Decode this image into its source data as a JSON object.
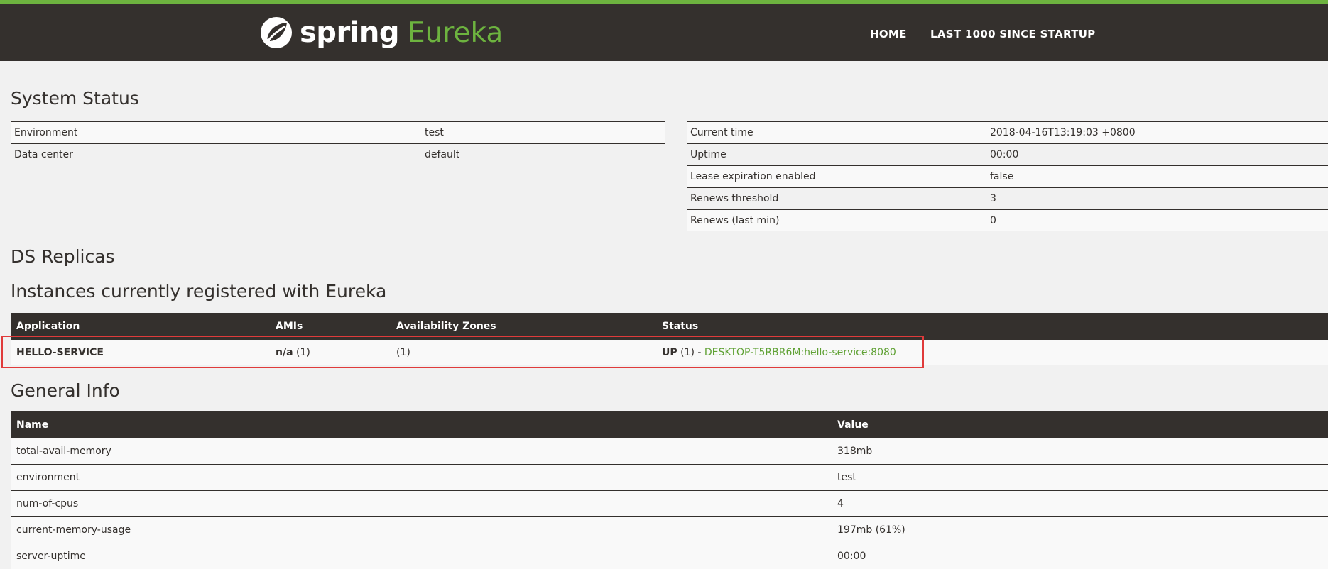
{
  "header": {
    "logo_spring": "spring",
    "logo_eureka": "Eureka",
    "nav_home": "HOME",
    "nav_last": "LAST 1000 SINCE STARTUP"
  },
  "colors": {
    "brand_green": "#6db33f",
    "header_bg": "#34302d",
    "highlight": "#e03b3b"
  },
  "system_status": {
    "title": "System Status",
    "left": [
      {
        "label": "Environment",
        "value": "test"
      },
      {
        "label": "Data center",
        "value": "default"
      }
    ],
    "right": [
      {
        "label": "Current time",
        "value": "2018-04-16T13:19:03 +0800"
      },
      {
        "label": "Uptime",
        "value": "00:00"
      },
      {
        "label": "Lease expiration enabled",
        "value": "false"
      },
      {
        "label": "Renews threshold",
        "value": "3"
      },
      {
        "label": "Renews (last min)",
        "value": "0"
      }
    ]
  },
  "ds_replicas": {
    "title": "DS Replicas"
  },
  "instances": {
    "title": "Instances currently registered with Eureka",
    "columns": [
      "Application",
      "AMIs",
      "Availability Zones",
      "Status"
    ],
    "rows": [
      {
        "application": "HELLO-SERVICE",
        "ami_name": "n/a",
        "ami_count": " (1)",
        "zones": "(1)",
        "status_state": "UP",
        "status_count": " (1) - ",
        "status_link": "DESKTOP-T5RBR6M:hello-service:8080"
      }
    ]
  },
  "general_info": {
    "title": "General Info",
    "columns": [
      "Name",
      "Value"
    ],
    "rows": [
      {
        "name": "total-avail-memory",
        "value": "318mb"
      },
      {
        "name": "environment",
        "value": "test"
      },
      {
        "name": "num-of-cpus",
        "value": "4"
      },
      {
        "name": "current-memory-usage",
        "value": "197mb (61%)"
      },
      {
        "name": "server-uptime",
        "value": "00:00"
      }
    ]
  }
}
